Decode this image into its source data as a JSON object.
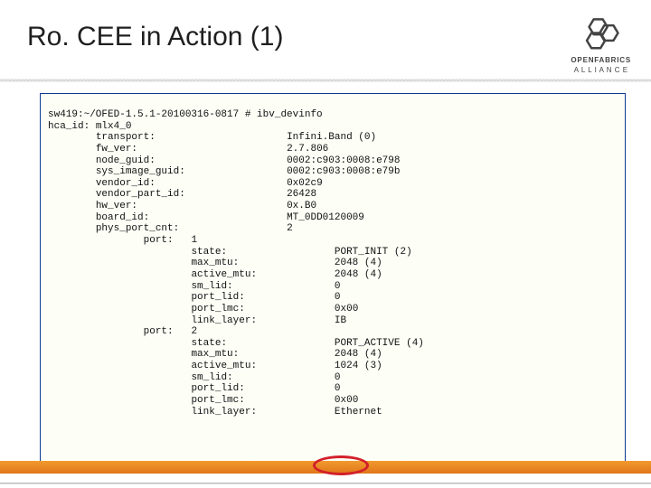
{
  "header": {
    "title": "Ro. CEE in Action (1)",
    "logo_top": "OPENFABRICS",
    "logo_bottom": "A L L I A N C E"
  },
  "terminal": {
    "prompt": "sw419:~/OFED-1.5.1-20100316-0817 # ibv_devinfo",
    "hca_label": "hca_id:",
    "hca_value": "mlx4_0",
    "fields": {
      "transport_label": "transport:",
      "transport_value": "Infini.Band (0)",
      "fw_ver_label": "fw_ver:",
      "fw_ver_value": "2.7.806",
      "node_guid_label": "node_guid:",
      "node_guid_value": "0002:c903:0008:e798",
      "sys_image_guid_label": "sys_image_guid:",
      "sys_image_guid_value": "0002:c903:0008:e79b",
      "vendor_id_label": "vendor_id:",
      "vendor_id_value": "0x02c9",
      "vendor_part_id_label": "vendor_part_id:",
      "vendor_part_id_value": "26428",
      "hw_ver_label": "hw_ver:",
      "hw_ver_value": "0x.B0",
      "board_id_label": "board_id:",
      "board_id_value": "MT_0DD0120009",
      "phys_port_cnt_label": "phys_port_cnt:",
      "phys_port_cnt_value": "2"
    },
    "port_label": "port:",
    "ports": [
      {
        "num": "1",
        "state_label": "state:",
        "state_value": "PORT_INIT (2)",
        "max_mtu_label": "max_mtu:",
        "max_mtu_value": "2048 (4)",
        "active_mtu_label": "active_mtu:",
        "active_mtu_value": "2048 (4)",
        "sm_lid_label": "sm_lid:",
        "sm_lid_value": "0",
        "port_lid_label": "port_lid:",
        "port_lid_value": "0",
        "port_lmc_label": "port_lmc:",
        "port_lmc_value": "0x00",
        "link_layer_label": "link_layer:",
        "link_layer_value": "IB"
      },
      {
        "num": "2",
        "state_label": "state:",
        "state_value": "PORT_ACTIVE (4)",
        "max_mtu_label": "max_mtu:",
        "max_mtu_value": "2048 (4)",
        "active_mtu_label": "active_mtu:",
        "active_mtu_value": "1024 (3)",
        "sm_lid_label": "sm_lid:",
        "sm_lid_value": "0",
        "port_lid_label": "port_lid:",
        "port_lid_value": "0",
        "port_lmc_label": "port_lmc:",
        "port_lmc_value": "0x00",
        "link_layer_label": "link_layer:",
        "link_layer_value": "Ethernet"
      }
    ]
  }
}
